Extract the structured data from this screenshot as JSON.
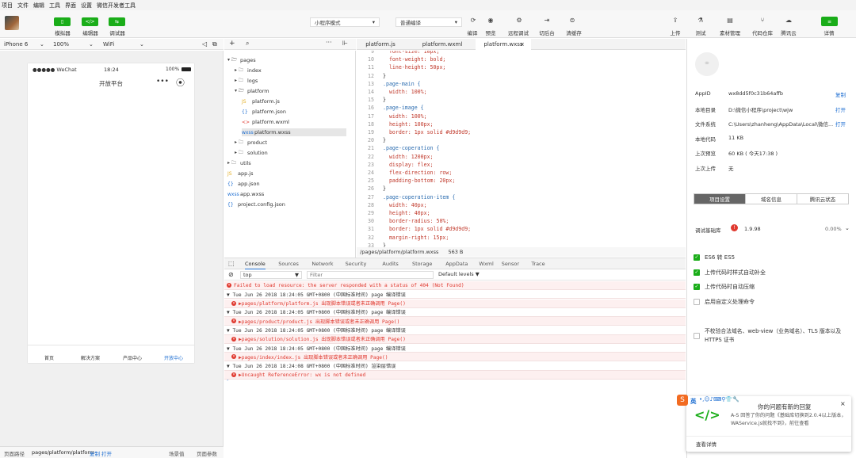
{
  "menubar": [
    "项目",
    "文件",
    "编辑",
    "工具",
    "界面",
    "设置",
    "微信开发者工具"
  ],
  "toolbar": {
    "simulator": "模拟器",
    "editor": "编辑器",
    "debugger": "调试器",
    "mode": "小程序模式",
    "compile": "普通编译",
    "actions": [
      "编译",
      "预览",
      "远程调试",
      "切后台",
      "清缓存"
    ],
    "right": [
      "上传",
      "测试",
      "素材管理",
      "代码仓库",
      "腾讯云",
      "详情"
    ]
  },
  "simulator": {
    "device": "iPhone 6",
    "zoom": "100%",
    "network": "WiFi",
    "carrier": "●●●●● WeChat",
    "time": "18:24",
    "battery": "100%",
    "nav_title": "开放平台",
    "tabbar": [
      "首页",
      "解决方案",
      "产品中心",
      "开放中心"
    ]
  },
  "statusbar": {
    "label": "页面路径",
    "path": "pages/platform/platform",
    "copy": "复制",
    "open": "打开",
    "scene": "场景值",
    "params": "页面参数"
  },
  "tree": [
    {
      "label": "pages",
      "icon": "▾ 🗁",
      "indent": 0
    },
    {
      "label": "index",
      "icon": "▸ 🗀",
      "indent": 1
    },
    {
      "label": "logs",
      "icon": "▸ 🗀",
      "indent": 1
    },
    {
      "label": "platform",
      "icon": "▾ 🗁",
      "indent": 1
    },
    {
      "label": "platform.js",
      "icon": "JS",
      "indent": 2
    },
    {
      "label": "platform.json",
      "icon": "{}",
      "indent": 2
    },
    {
      "label": "platform.wxml",
      "icon": "<>",
      "indent": 2
    },
    {
      "label": "platform.wxss",
      "icon": "wxss",
      "indent": 2,
      "active": true
    },
    {
      "label": "product",
      "icon": "▸ 🗀",
      "indent": 1
    },
    {
      "label": "solution",
      "icon": "▸ 🗀",
      "indent": 1
    },
    {
      "label": "utils",
      "icon": "▸ 🗀",
      "indent": 0
    },
    {
      "label": "app.js",
      "icon": "JS",
      "indent": 0
    },
    {
      "label": "app.json",
      "icon": "{}",
      "indent": 0
    },
    {
      "label": "app.wxss",
      "icon": "wxss",
      "indent": 0
    },
    {
      "label": "project.config.json",
      "icon": "{}",
      "indent": 0
    }
  ],
  "tabs": [
    "platform.js",
    "platform.wxml",
    "platform.wxss"
  ],
  "code": [
    {
      "n": "9",
      "t": "  font-size: 10px;"
    },
    {
      "n": "10",
      "t": "  font-weight: bold;"
    },
    {
      "n": "11",
      "t": "  line-height: 50px;"
    },
    {
      "n": "12",
      "t": "}"
    },
    {
      "n": "13",
      "t": ".page-main {"
    },
    {
      "n": "14",
      "t": "  width: 100%;"
    },
    {
      "n": "15",
      "t": "}"
    },
    {
      "n": "16",
      "t": ".page-image {"
    },
    {
      "n": "17",
      "t": "  width: 100%;"
    },
    {
      "n": "18",
      "t": "  height: 100px;"
    },
    {
      "n": "19",
      "t": "  border: 1px solid #d9d9d9;"
    },
    {
      "n": "20",
      "t": "}"
    },
    {
      "n": "21",
      "t": ".page-coperation {"
    },
    {
      "n": "22",
      "t": "  width: 1200px;"
    },
    {
      "n": "23",
      "t": "  display: flex;"
    },
    {
      "n": "24",
      "t": "  flex-direction: row;"
    },
    {
      "n": "25",
      "t": "  padding-bottom: 20px;"
    },
    {
      "n": "26",
      "t": "}"
    },
    {
      "n": "27",
      "t": ".page-coperation-item {"
    },
    {
      "n": "28",
      "t": "  width: 40px;"
    },
    {
      "n": "29",
      "t": "  height: 40px;"
    },
    {
      "n": "30",
      "t": "  border-radius: 50%;"
    },
    {
      "n": "31",
      "t": "  border: 1px solid #d9d9d9;"
    },
    {
      "n": "32",
      "t": "  margin-right: 15px;"
    },
    {
      "n": "33",
      "t": "}"
    }
  ],
  "pathbar": {
    "path": "/pages/platform/platform.wxss",
    "size": "563 B"
  },
  "devtabs": [
    "Console",
    "Sources",
    "Network",
    "Security",
    "Audits",
    "Storage",
    "AppData",
    "Wxml",
    "Sensor",
    "Trace"
  ],
  "filter": {
    "context": "top",
    "placeholder": "Filter",
    "levels": "Default levels ▼"
  },
  "console": [
    {
      "type": "err",
      "text": "Failed to load resource: the server responded with a status of 404 (Not Found)"
    },
    {
      "type": "info",
      "text": "▼ Tue Jun 26 2018 18:24:05 GMT+0800 (中国标准时间) page 编译错误"
    },
    {
      "type": "errin",
      "text": "▶pages/platform/platform.js 出现脚本错误或者未正确调用 Page()"
    },
    {
      "type": "info",
      "text": "▼ Tue Jun 26 2018 18:24:05 GMT+0800 (中国标准时间) page 编译错误"
    },
    {
      "type": "errin",
      "text": "▶pages/product/product.js 出现脚本错误或者未正确调用 Page()"
    },
    {
      "type": "info",
      "text": "▼ Tue Jun 26 2018 18:24:05 GMT+0800 (中国标准时间) page 编译错误"
    },
    {
      "type": "errin",
      "text": "▶pages/solution/solution.js 出现脚本错误或者未正确调用 Page()"
    },
    {
      "type": "info",
      "text": "▼ Tue Jun 26 2018 18:24:05 GMT+0800 (中国标准时间) page 编译错误"
    },
    {
      "type": "errin",
      "text": "▶pages/index/index.js 出现脚本错误或者未正确调用 Page()"
    },
    {
      "type": "info",
      "text": "▼ Tue Jun 26 2018 18:24:08 GMT+0800 (中国标准时间) 渲染层错误"
    },
    {
      "type": "errin",
      "text": "▶Uncaught ReferenceError: wx is not defined"
    }
  ],
  "details": {
    "rows": [
      {
        "k": "AppID",
        "v": "wx8dd5f0c31b64affb",
        "a": "复制"
      },
      {
        "k": "本地目录",
        "v": "D:\\微信小程序\\project\\wjw",
        "a": "打开"
      },
      {
        "k": "文件系统",
        "v": "C:\\Users\\zhanheng\\AppData\\Local\\微信...",
        "a": "打开"
      },
      {
        "k": "本地代码",
        "v": "11 KB",
        "a": ""
      },
      {
        "k": "上次预览",
        "v": "60 KB ( 今天17:38 )",
        "a": ""
      },
      {
        "k": "上次上传",
        "v": "无",
        "a": ""
      }
    ],
    "seg": [
      "项目设置",
      "域名信息",
      "腾讯云状态"
    ],
    "lib_label": "调试基础库",
    "lib_version": "1.9.98",
    "lib_pct": "0.00%",
    "checks": [
      {
        "label": "ES6 转 ES5",
        "on": true
      },
      {
        "label": "上传代码时样式自动补全",
        "on": true
      },
      {
        "label": "上传代码时自动压缩",
        "on": true
      },
      {
        "label": "启用自定义处理命令",
        "on": false
      }
    ],
    "domain_check": "不校验合法域名、web-view（业务域名）、TLS 版本以及 HTTPS 证书"
  },
  "popup": {
    "title": "你的问题有新的回复",
    "body": "A-S 回答了你的问题《基础库切换到2.0.4以上版本，WAService.js就找不到》，前往查看",
    "link": "查看详情",
    "ime": "英"
  },
  "colors": {
    "accent": "#1aad19",
    "link": "#1f6fd2",
    "error": "#e0392f"
  }
}
